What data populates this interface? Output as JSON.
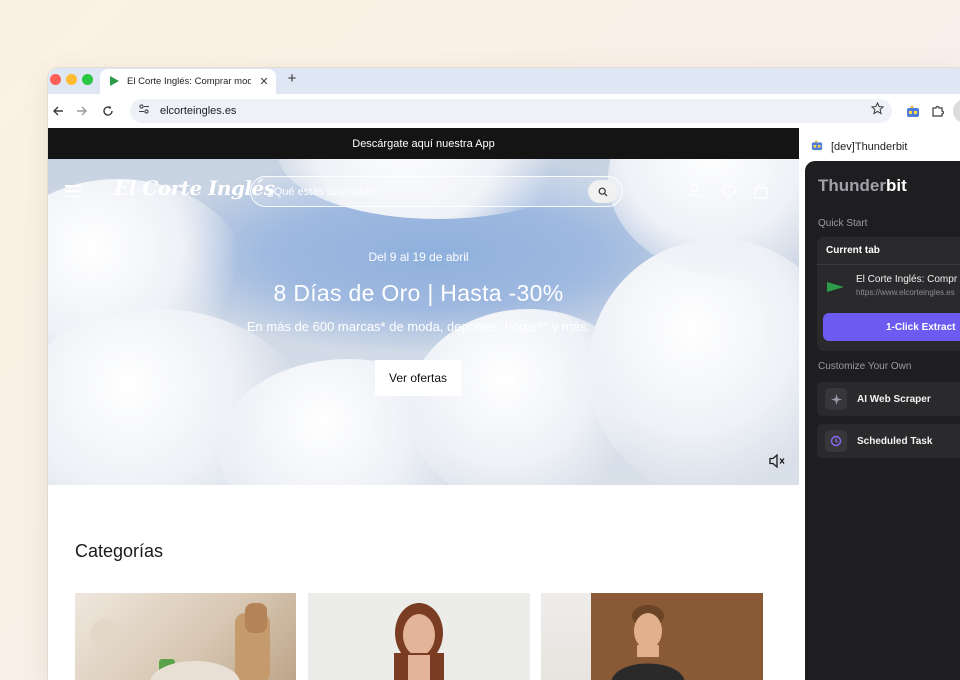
{
  "browser": {
    "tab": {
      "title": "El Corte Inglés: Comprar moda"
    },
    "url": "elcorteingles.es"
  },
  "site": {
    "promo_bar": "Descárgate aquí nuestra App",
    "logo": "El Corte Inglés",
    "search_placeholder": "¿Qué estás buscando?",
    "hero": {
      "date": "Del 9 al 19 de abril",
      "title": "8 Días de Oro | Hasta -30%",
      "subtitle": "En más de 600 marcas* de moda, deportes, hogar** y más.",
      "cta": "Ver ofertas"
    },
    "categories_title": "Categorías"
  },
  "sidebar": {
    "header": "[dev]Thunderbit",
    "brand_light": "Thunder",
    "brand_bold": "bit",
    "quick_start": "Quick Start",
    "current_tab": "Current tab",
    "site_title": "El Corte Inglés: Compr",
    "site_url": "https://www.elcorteingles.es",
    "extract_button": "1-Click Extract",
    "customize": "Customize Your Own",
    "ai_scraper": "AI Web Scraper",
    "scheduled_task": "Scheduled Task"
  },
  "colors": {
    "accent": "#6c5bf0",
    "brand_green": "#2e9b4b",
    "panel_bg": "#1e1e20",
    "promo_bg": "#141414"
  },
  "icons": [
    "favicon-flag-icon",
    "back-arrow-icon",
    "forward-arrow-icon",
    "reload-icon",
    "site-settings-icon",
    "bookmark-star-icon",
    "extension-thunderbit-icon",
    "extensions-puzzle-icon",
    "menu-icon",
    "search-icon",
    "user-icon",
    "heart-icon",
    "bag-icon",
    "mute-icon",
    "sparkle-icon",
    "schedule-icon"
  ]
}
